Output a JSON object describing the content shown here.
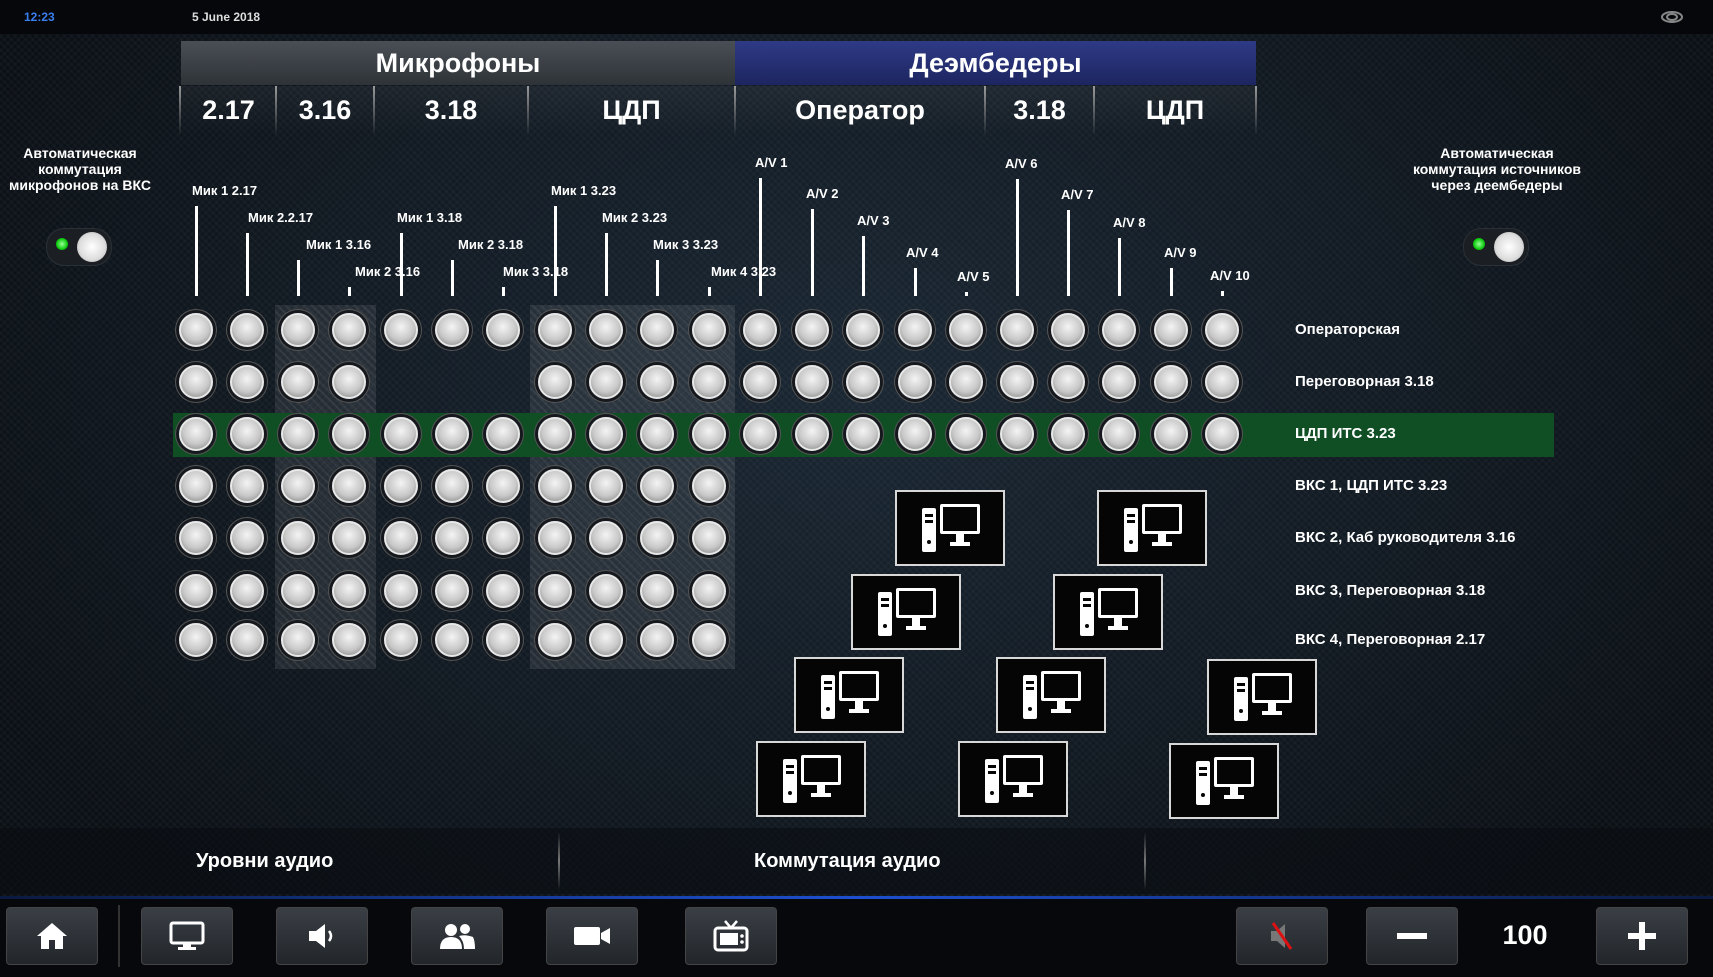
{
  "status": {
    "time": "12:23",
    "date": "5 June 2018"
  },
  "groups": {
    "mics": "Микрофоны",
    "dembedders": "Деэмбедеры"
  },
  "subgroups": [
    "2.17",
    "3.16",
    "3.18",
    "ЦДП",
    "Оператор",
    "3.18",
    "ЦДП"
  ],
  "left_toggle": {
    "label": "Автоматическая коммутация микрофонов на ВКС",
    "state": "on"
  },
  "right_toggle": {
    "label": "Автоматическая коммутация источников через деембедеры",
    "state": "on"
  },
  "sources": [
    "Мик 1 2.17",
    "Мик 2.2.17",
    "Мик 1 3.16",
    "Мик 2 3.16",
    "Мик 1 3.18",
    "Мик 2 3.18",
    "Мик 3 3.18",
    "Мик 1 3.23",
    "Мик 2 3.23",
    "Мик 3 3.23",
    "Мик 4 3.23",
    "A/V 1",
    "A/V 2",
    "A/V 3",
    "A/V 4",
    "A/V 5",
    "A/V 6",
    "A/V 7",
    "A/V 8",
    "A/V 9",
    "A/V 10"
  ],
  "destinations": [
    "Операторская",
    "Переговорная 3.18",
    "ЦДП ИТС 3.23",
    "ВКС 1, ЦДП ИТС 3.23",
    "ВКС 2, Каб руководителя 3.16",
    "ВКС 3, Переговорная 3.18",
    "ВКС 4, Переговорная 2.17"
  ],
  "highlighted_row": "ЦДП ИТС 3.23",
  "tabs": {
    "levels": "Уровни аудио",
    "routing": "Коммутация аудио"
  },
  "footer": {
    "volume": "100"
  },
  "icons": {
    "home": "home-icon",
    "display": "monitor-icon",
    "sound": "speaker-icon",
    "people": "people-icon",
    "camera": "camera-icon",
    "tv": "tv-icon",
    "mute": "mute-icon",
    "minus": "minus-icon",
    "plus": "plus-icon",
    "pc": "computer-icon"
  }
}
